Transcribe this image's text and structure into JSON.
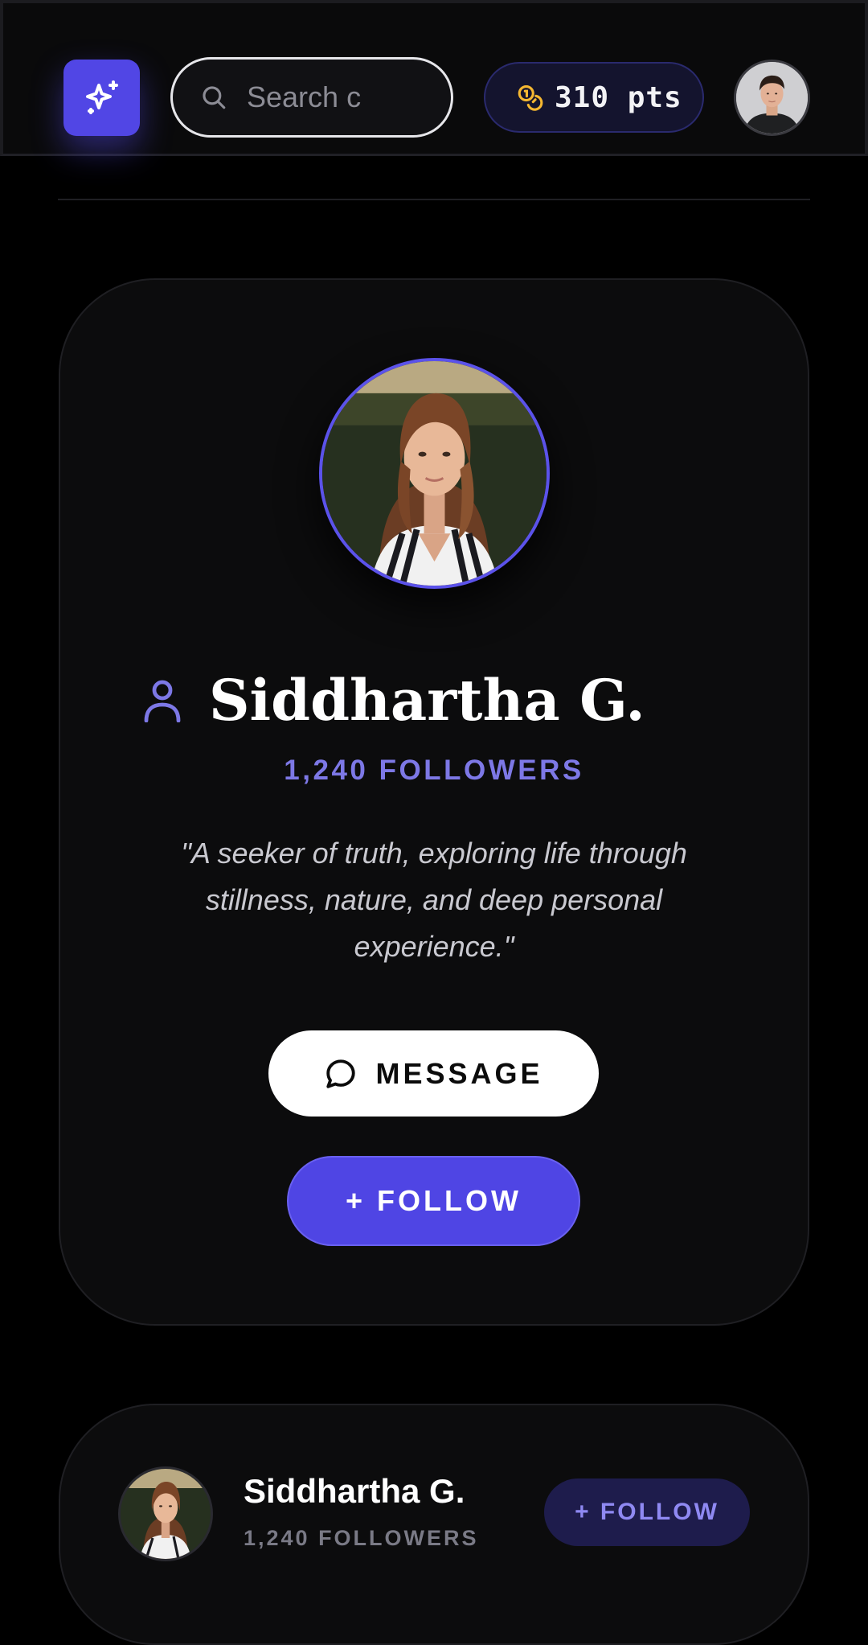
{
  "header": {
    "logo_icon": "sparkles-icon",
    "search": {
      "placeholder": "Search c",
      "icon": "search-icon"
    },
    "points": {
      "label": "310 pts",
      "icon": "coins-icon"
    },
    "user_avatar": "avatar-man"
  },
  "profile": {
    "name": "Siddhartha G.",
    "name_icon": "user-icon",
    "followers": "1,240 FOLLOWERS",
    "bio_line1": "\"A seeker of truth, exploring life through",
    "bio_line2": "stillness, nature, and deep personal",
    "bio_line3": "experience.\"",
    "message_label": "MESSAGE",
    "message_icon": "chat-bubble-icon",
    "follow_label": "+ FOLLOW"
  },
  "suggested": {
    "name": "Siddhartha G.",
    "followers": "1,240 FOLLOWERS",
    "follow_label": "+ FOLLOW"
  },
  "colors": {
    "background": "#000000",
    "accent": "#5146e5",
    "accent_text": "#7d78e6",
    "points_gold": "#f5b731"
  }
}
